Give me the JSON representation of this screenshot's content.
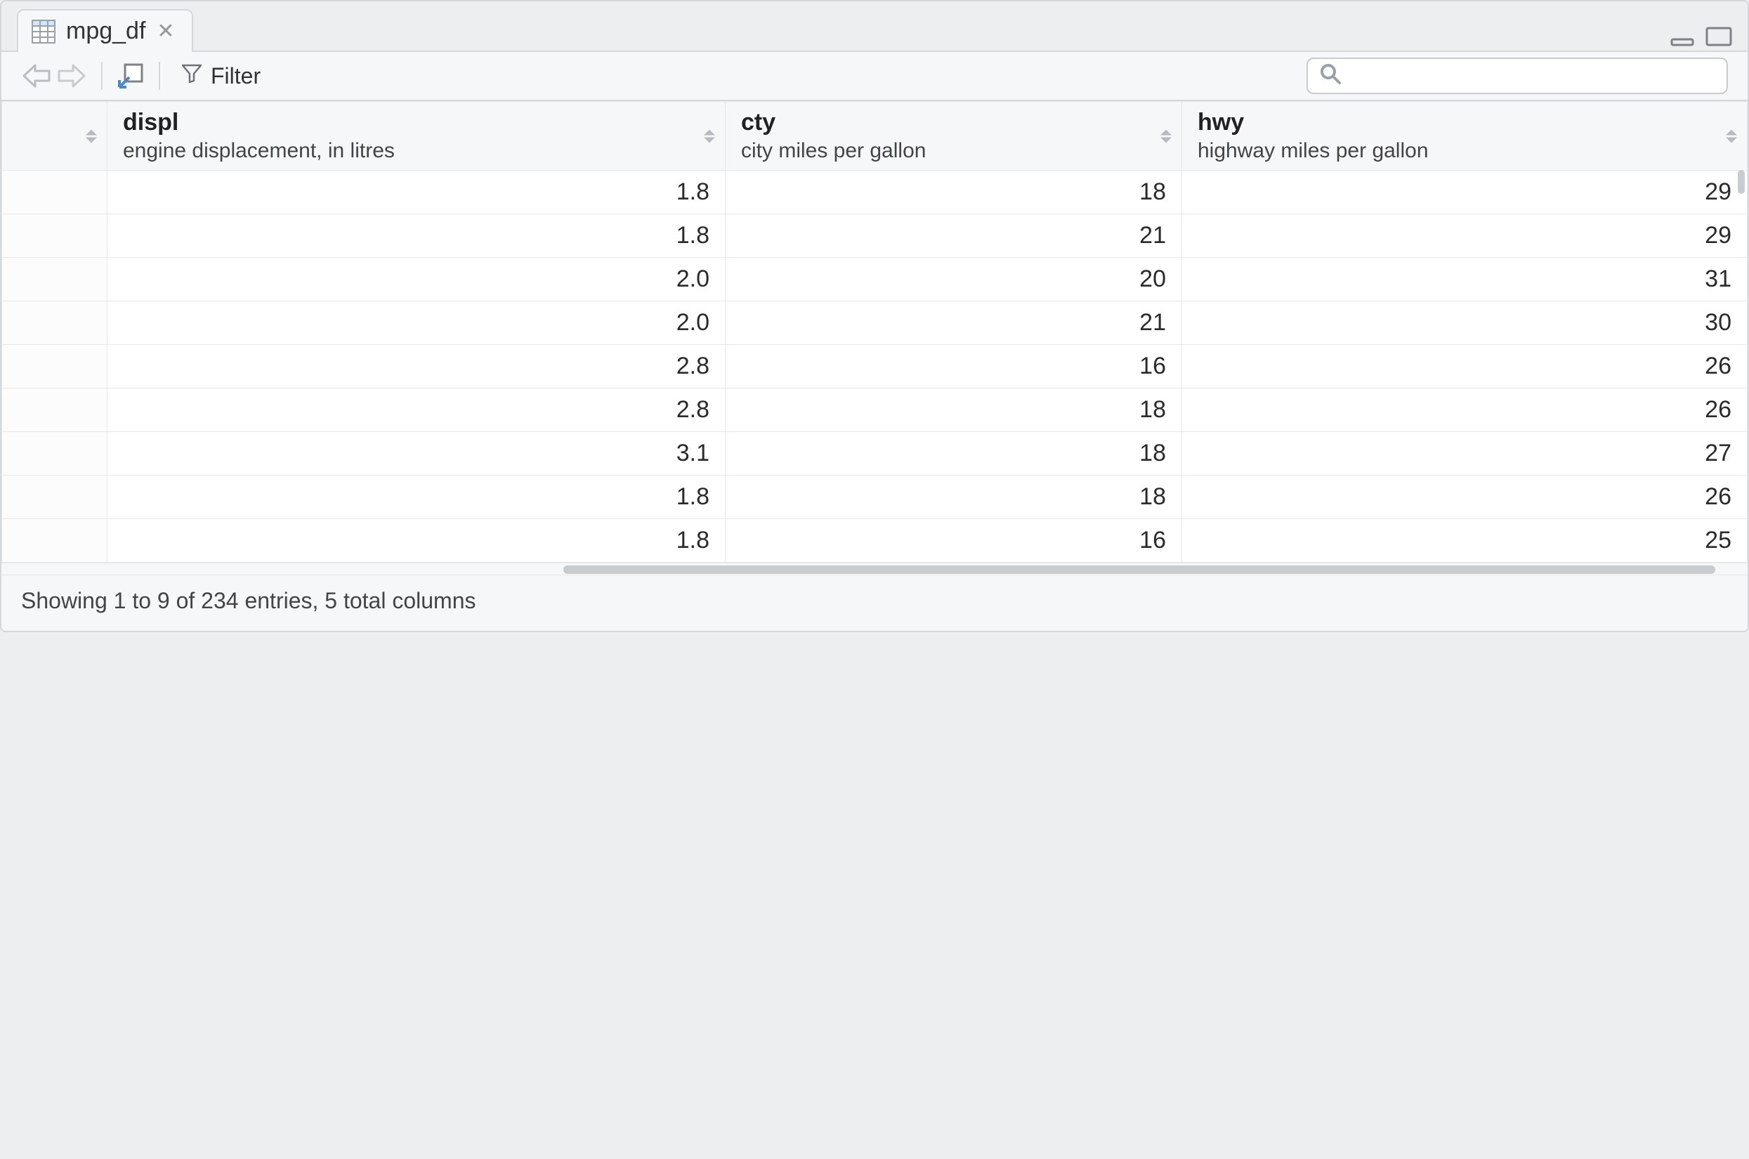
{
  "tab": {
    "title": "mpg_df"
  },
  "toolbar": {
    "filter_label": "Filter",
    "search_placeholder": ""
  },
  "columns": [
    {
      "name": "displ",
      "desc": "engine displacement, in litres"
    },
    {
      "name": "cty",
      "desc": "city miles per gallon"
    },
    {
      "name": "hwy",
      "desc": "highway miles per gallon"
    }
  ],
  "rows": [
    {
      "displ": "1.8",
      "cty": "18",
      "hwy": "29"
    },
    {
      "displ": "1.8",
      "cty": "21",
      "hwy": "29"
    },
    {
      "displ": "2.0",
      "cty": "20",
      "hwy": "31"
    },
    {
      "displ": "2.0",
      "cty": "21",
      "hwy": "30"
    },
    {
      "displ": "2.8",
      "cty": "16",
      "hwy": "26"
    },
    {
      "displ": "2.8",
      "cty": "18",
      "hwy": "26"
    },
    {
      "displ": "3.1",
      "cty": "18",
      "hwy": "27"
    },
    {
      "displ": "1.8",
      "cty": "18",
      "hwy": "26"
    },
    {
      "displ": "1.8",
      "cty": "16",
      "hwy": "25"
    }
  ],
  "status": {
    "text": "Showing 1 to 9 of 234 entries, 5 total columns"
  },
  "chart_data": {
    "type": "table",
    "title": "mpg_df",
    "columns": [
      "displ",
      "cty",
      "hwy"
    ],
    "column_descriptions": {
      "displ": "engine displacement, in litres",
      "cty": "city miles per gallon",
      "hwy": "highway miles per gallon"
    },
    "rows": [
      [
        1.8,
        18,
        29
      ],
      [
        1.8,
        21,
        29
      ],
      [
        2.0,
        20,
        31
      ],
      [
        2.0,
        21,
        30
      ],
      [
        2.8,
        16,
        26
      ],
      [
        2.8,
        18,
        26
      ],
      [
        3.1,
        18,
        27
      ],
      [
        1.8,
        18,
        26
      ],
      [
        1.8,
        16,
        25
      ]
    ],
    "total_entries": 234,
    "total_columns": 5,
    "showing_from": 1,
    "showing_to": 9
  }
}
